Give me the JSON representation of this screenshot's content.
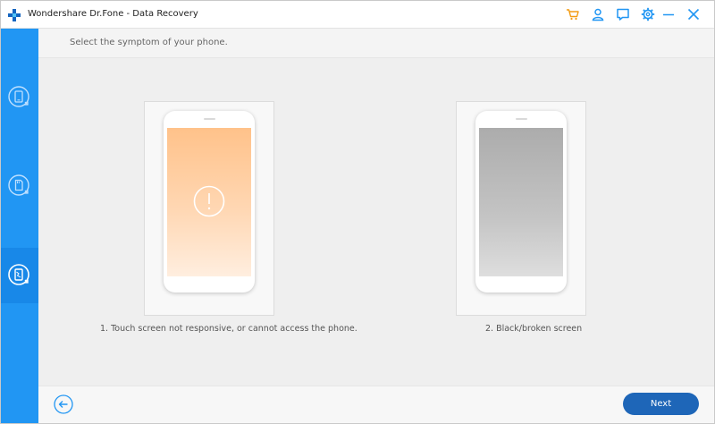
{
  "window": {
    "title": "Wondershare Dr.Fone - Data Recovery",
    "logo_icon": "plus-logo-icon",
    "controls": [
      {
        "name": "cart-icon",
        "color": "#f39c12"
      },
      {
        "name": "account-icon",
        "color": "#2196f3"
      },
      {
        "name": "feedback-icon",
        "color": "#2196f3"
      },
      {
        "name": "settings-icon",
        "color": "#2196f3"
      },
      {
        "name": "minimize-icon",
        "color": "#2196f3"
      },
      {
        "name": "close-icon",
        "color": "#2196f3"
      }
    ]
  },
  "sidebar": {
    "color": "#2196f3",
    "items": [
      {
        "name": "recover-device-icon"
      },
      {
        "name": "recover-sd-icon"
      },
      {
        "name": "recover-broken-icon",
        "active": true
      }
    ]
  },
  "main": {
    "prompt": "Select the symptom of your phone.",
    "options": [
      {
        "label": "1. Touch screen not responsive, or cannot access the phone.",
        "screen": "orange",
        "icon": "alert-circle-icon"
      },
      {
        "label": "2. Black/broken screen",
        "screen": "grey"
      }
    ]
  },
  "footer": {
    "back_icon": "arrow-left-circle-icon",
    "next_label": "Next",
    "accent": "#1e66b8"
  }
}
